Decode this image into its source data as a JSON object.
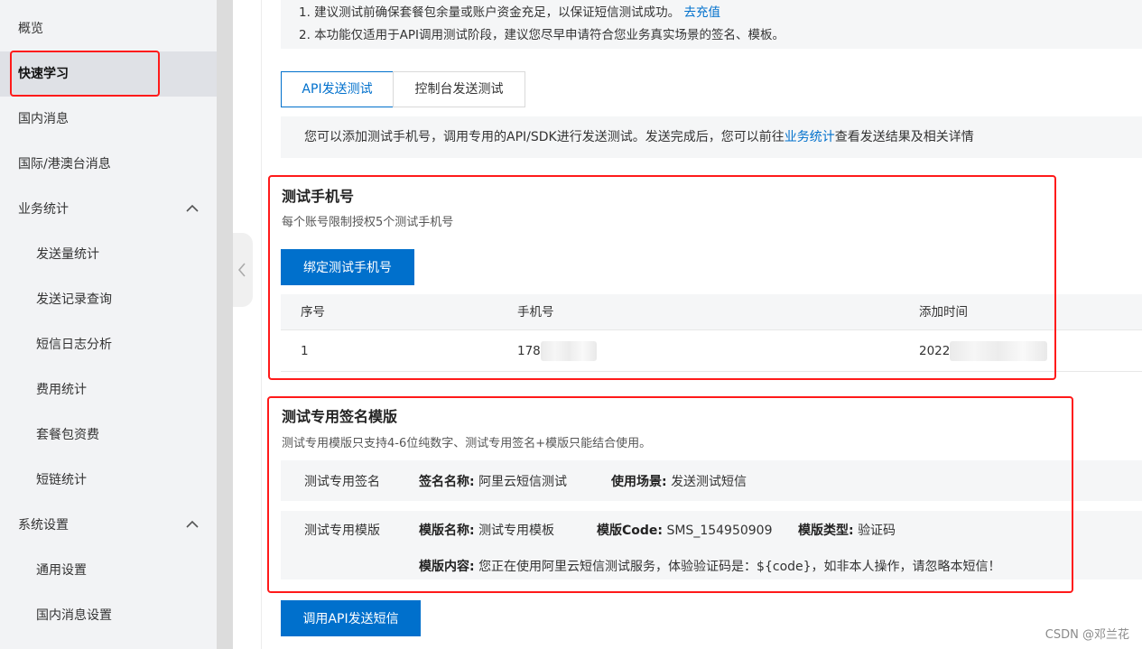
{
  "sidebar": {
    "items": [
      {
        "label": "概览"
      },
      {
        "label": "快速学习"
      },
      {
        "label": "国内消息"
      },
      {
        "label": "国际/港澳台消息"
      },
      {
        "label": "业务统计"
      },
      {
        "label": "发送量统计"
      },
      {
        "label": "发送记录查询"
      },
      {
        "label": "短信日志分析"
      },
      {
        "label": "费用统计"
      },
      {
        "label": "套餐包资费"
      },
      {
        "label": "短链统计"
      },
      {
        "label": "系统设置"
      },
      {
        "label": "通用设置"
      },
      {
        "label": "国内消息设置"
      }
    ]
  },
  "notice": {
    "line1": "1. 建议测试前确保套餐包余量或账户资金充足，以保证短信测试成功。",
    "line1_link": "去充值",
    "line2": "2. 本功能仅适用于API调用测试阶段，建议您尽早申请符合您业务真实场景的签名、模板。"
  },
  "tabs": [
    {
      "label": "API发送测试"
    },
    {
      "label": "控制台发送测试"
    }
  ],
  "description": {
    "prefix": "您可以添加测试手机号，调用专用的API/SDK进行发送测试。发送完成后，您可以前往",
    "link": "业务统计",
    "suffix": "查看发送结果及相关详情"
  },
  "test_phone": {
    "title": "测试手机号",
    "subtitle": "每个账号限制授权5个测试手机号",
    "bind_button": "绑定测试手机号",
    "columns": [
      "序号",
      "手机号",
      "添加时间"
    ],
    "rows": [
      {
        "index": "1",
        "phone": "178",
        "time": "2022"
      }
    ]
  },
  "test_template": {
    "title": "测试专用签名模版",
    "subtitle": "测试专用模版只支持4-6位纯数字、测试专用签名+模版只能结合使用。",
    "signature": {
      "label": "测试专用签名",
      "name_key": "签名名称:",
      "name_value": "阿里云短信测试",
      "scene_key": "使用场景:",
      "scene_value": "发送测试短信"
    },
    "template": {
      "label": "测试专用模版",
      "name_key": "模版名称:",
      "name_value": "测试专用模板",
      "code_key": "模版Code:",
      "code_value": "SMS_154950909",
      "type_key": "模版类型:",
      "type_value": "验证码",
      "content_key": "模版内容:",
      "content_value": "您正在使用阿里云短信测试服务，体验验证码是：${code}，如非本人操作，请忽略本短信！"
    }
  },
  "send_button": "调用API发送短信",
  "watermark": "CSDN @邓兰花",
  "colors": {
    "accent": "#0070cc",
    "highlight_box": "#ff1a1a",
    "sidebar_bg": "#f2f3f5"
  }
}
